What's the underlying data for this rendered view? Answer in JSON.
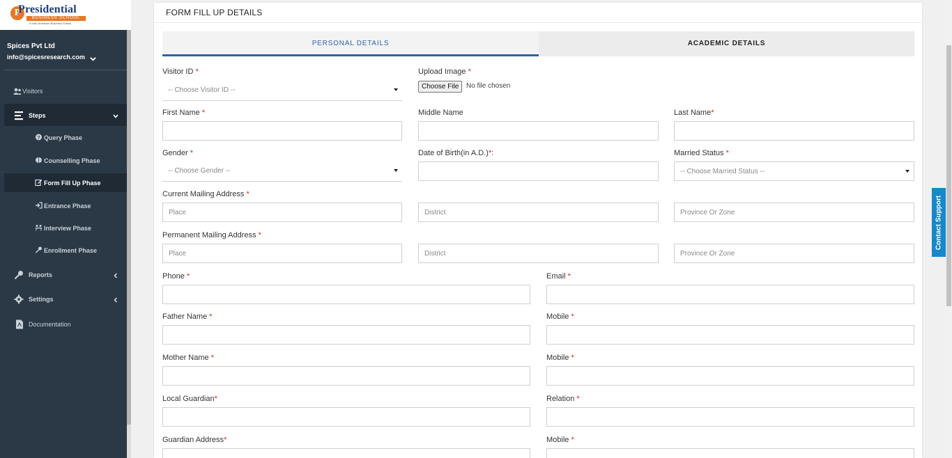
{
  "brand": {
    "logo_letter": "P",
    "logo_name": "Presidential",
    "logo_band": "BUSINESS SCHOOL",
    "logo_tagline": "A Indo-American Business School"
  },
  "user": {
    "company": "Spices Pvt Ltd",
    "email": "info@spicesresearch.com"
  },
  "nav": {
    "visitors": "Visitors",
    "steps": "Steps",
    "query_phase": "Query Phase",
    "counselling_phase": "Counselling Phase",
    "form_fill_up_phase": "Form Fill Up Phase",
    "entrance_phase": "Entrance Phase",
    "interview_phase": "Interview Phase",
    "enrollment_phase": "Enrollment Phase",
    "reports": "Reports",
    "settings": "Settings",
    "documentation": "Documentation"
  },
  "page": {
    "title": "FORM FILL UP DETAILS",
    "tabs": [
      "PERSONAL DETAILS",
      "ACADEMIC DETAILS"
    ],
    "active_tab": "PERSONAL DETAILS",
    "contact_support": "Contact Support"
  },
  "form": {
    "visitor_id_label": "Visitor ID",
    "visitor_id_value": "-- Choose Visitor ID --",
    "upload_image_label": "Upload Image",
    "choose_file": "Choose File",
    "no_file": "No file chosen",
    "first_name_label": "First Name",
    "middle_name_label": "Middle Name",
    "last_name_label": "Last Name",
    "gender_label": "Gender",
    "gender_value": "-- Choose Gender --",
    "dob_label": "Date of Birth(in A.D.)",
    "married_label": "Married Status",
    "married_value": "-- Choose Married Status --",
    "current_address_label": "Current Mailing Address",
    "permanent_address_label": "Permanent Mailing Address",
    "place_placeholder": "Place",
    "district_placeholder": "District",
    "province_placeholder": "Province Or Zone",
    "phone_label": "Phone",
    "email_label": "Email",
    "father_name_label": "Father Name",
    "mother_name_label": "Mother Name",
    "mobile_label": "Mobile",
    "local_guardian_label": "Local Guardian",
    "relation_label": "Relation",
    "guardian_address_label": "Guardian Address",
    "required_mark": "*",
    "dob_suffix": "*:"
  },
  "colors": {
    "sidebar": "#2b3947",
    "accent": "#2d64a8",
    "required": "#d9261c",
    "support": "#1788c9",
    "logo_orange": "#e87722"
  }
}
